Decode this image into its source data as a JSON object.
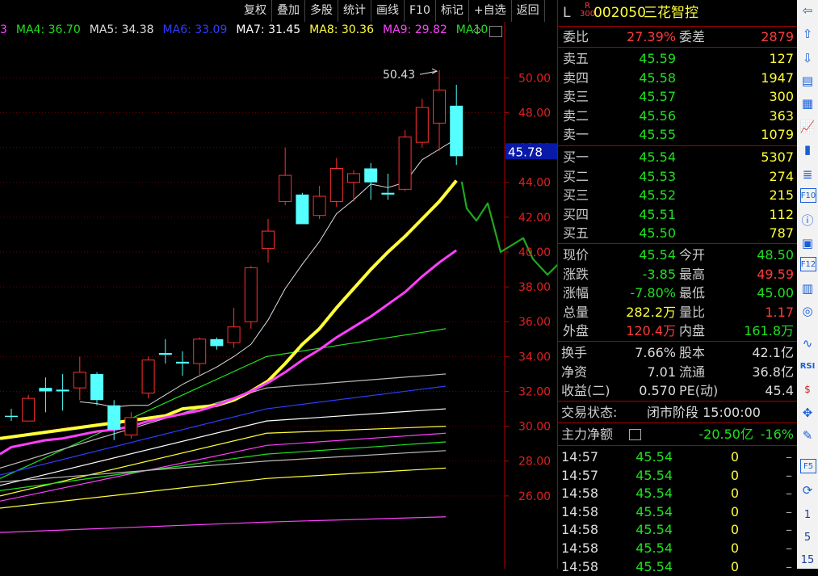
{
  "toolbar": {
    "buttons": [
      "复权",
      "叠加",
      "多股",
      "统计",
      "画线",
      "F10",
      "标记",
      "+自选",
      "返回"
    ]
  },
  "ma_bar": [
    {
      "label": "3",
      "color": "#ff40ff"
    },
    {
      "label": "MA4: 36.70",
      "color": "#21e021"
    },
    {
      "label": "MA5: 34.38",
      "color": "#dddddd"
    },
    {
      "label": "MA6: 33.09",
      "color": "#2f3cff"
    },
    {
      "label": "MA7: 31.45",
      "color": "#ffffff"
    },
    {
      "label": "MA8: 30.36",
      "color": "#ffff3a"
    },
    {
      "label": "MA9: 29.82",
      "color": "#ff40ff"
    },
    {
      "label": "MA10",
      "color": "#21e021"
    }
  ],
  "chart_data": {
    "type": "candlestick",
    "y_ticks": [
      "50.00",
      "48.00",
      "46.00",
      "44.00",
      "42.00",
      "40.00",
      "38.00",
      "36.00",
      "34.00",
      "32.00",
      "30.00",
      "28.00",
      "26.00"
    ],
    "ylim": [
      24.0,
      51.5
    ],
    "current_price_label": "45.78",
    "current_price": 45.78,
    "high_marker": "50.43",
    "high_marker_value": 50.43,
    "candles": [
      {
        "open": 30.6,
        "close": 30.6,
        "high": 31.0,
        "low": 30.3,
        "color": "cyan"
      },
      {
        "open": 30.3,
        "close": 31.6,
        "high": 31.8,
        "low": 30.3,
        "color": "red"
      },
      {
        "open": 32.0,
        "close": 32.2,
        "high": 32.8,
        "low": 30.8,
        "color": "cyan"
      },
      {
        "open": 32.1,
        "close": 32.0,
        "high": 33.0,
        "low": 30.9,
        "color": "cyan"
      },
      {
        "open": 32.2,
        "close": 33.1,
        "high": 34.0,
        "low": 31.5,
        "color": "red"
      },
      {
        "open": 33.0,
        "close": 31.5,
        "high": 33.1,
        "low": 31.2,
        "color": "cyan"
      },
      {
        "open": 31.2,
        "close": 29.8,
        "high": 31.5,
        "low": 29.2,
        "color": "cyan"
      },
      {
        "open": 29.5,
        "close": 30.5,
        "high": 30.8,
        "low": 29.3,
        "color": "red"
      },
      {
        "open": 31.9,
        "close": 33.8,
        "high": 34.0,
        "low": 31.6,
        "color": "red"
      },
      {
        "open": 34.1,
        "close": 34.2,
        "high": 35.0,
        "low": 33.6,
        "color": "cyan"
      },
      {
        "open": 33.6,
        "close": 33.7,
        "high": 34.3,
        "low": 32.9,
        "color": "cyan"
      },
      {
        "open": 33.6,
        "close": 35.0,
        "high": 35.1,
        "low": 32.9,
        "color": "red"
      },
      {
        "open": 35.0,
        "close": 34.6,
        "high": 35.1,
        "low": 34.4,
        "color": "cyan"
      },
      {
        "open": 34.8,
        "close": 35.7,
        "high": 36.8,
        "low": 34.5,
        "color": "red"
      },
      {
        "open": 36.0,
        "close": 39.1,
        "high": 39.2,
        "low": 35.6,
        "color": "red"
      },
      {
        "open": 40.2,
        "close": 41.2,
        "high": 41.9,
        "low": 39.4,
        "color": "red"
      },
      {
        "open": 42.9,
        "close": 44.4,
        "high": 46.0,
        "low": 42.7,
        "color": "red"
      },
      {
        "open": 43.3,
        "close": 41.6,
        "high": 43.4,
        "low": 41.6,
        "color": "cyan"
      },
      {
        "open": 42.1,
        "close": 43.2,
        "high": 43.8,
        "low": 41.9,
        "color": "red"
      },
      {
        "open": 42.9,
        "close": 44.8,
        "high": 45.4,
        "low": 42.6,
        "color": "red"
      },
      {
        "open": 44.0,
        "close": 44.5,
        "high": 44.7,
        "low": 42.9,
        "color": "red"
      },
      {
        "open": 44.8,
        "close": 44.0,
        "high": 45.1,
        "low": 43.0,
        "color": "cyan"
      },
      {
        "open": 43.3,
        "close": 43.4,
        "high": 44.5,
        "low": 43.0,
        "color": "cyan"
      },
      {
        "open": 43.6,
        "close": 46.6,
        "high": 47.0,
        "low": 43.5,
        "color": "red"
      },
      {
        "open": 46.3,
        "close": 48.3,
        "high": 48.8,
        "low": 46.0,
        "color": "red"
      },
      {
        "open": 47.4,
        "close": 49.3,
        "high": 50.43,
        "low": 45.8,
        "color": "red"
      },
      {
        "open": 48.4,
        "close": 45.5,
        "high": 49.6,
        "low": 45.0,
        "color": "cyan"
      }
    ],
    "ma_lines": [
      {
        "name": "MA5",
        "color": "#dddddd",
        "width": 1,
        "values": [
          null,
          null,
          null,
          null,
          31.4,
          31.3,
          31.1,
          31.2,
          31.2,
          31.8,
          32.4,
          32.9,
          33.4,
          34.0,
          34.7,
          36.1,
          37.9,
          39.3,
          40.6,
          42.2,
          43.0,
          43.9,
          43.7,
          44.0,
          45.3,
          45.9,
          46.5
        ]
      },
      {
        "name": "MA10",
        "color": "#ffff3a",
        "width": 4,
        "values": [
          null,
          null,
          null,
          null,
          null,
          null,
          null,
          null,
          null,
          30.6,
          31.0,
          31.1,
          31.2,
          31.5,
          32.0,
          32.6,
          33.6,
          34.7,
          35.6,
          36.8,
          37.9,
          39.0,
          40.0,
          40.9,
          41.9,
          42.9,
          44.1
        ]
      },
      {
        "name": "MA20",
        "color": "#ff40ff",
        "width": 3,
        "values": [
          28.8,
          29.0,
          29.2,
          29.3,
          29.5,
          29.7,
          29.8,
          30.0,
          30.3,
          30.5,
          30.7,
          30.9,
          31.2,
          31.6,
          32.0,
          32.5,
          33.1,
          33.8,
          34.4,
          35.1,
          35.7,
          36.3,
          37.0,
          37.7,
          38.6,
          39.4,
          40.1
        ]
      }
    ],
    "thin_lines": [
      {
        "color": "#21e021",
        "values": [
          27.0,
          34.0,
          35.6
        ]
      },
      {
        "color": "#bbbbbb",
        "values": [
          27.6,
          32.2,
          33.0
        ]
      },
      {
        "color": "#2f3cff",
        "values": [
          27.2,
          31.0,
          32.3
        ]
      },
      {
        "color": "#ffffff",
        "values": [
          26.6,
          30.3,
          31.0
        ]
      },
      {
        "color": "#ffff3a",
        "values": [
          26.0,
          29.6,
          30.0
        ]
      },
      {
        "color": "#ff40ff",
        "values": [
          25.7,
          28.9,
          29.6
        ]
      },
      {
        "color": "#21e021",
        "values": [
          26.3,
          28.4,
          29.1
        ]
      },
      {
        "color": "#bbbbbb",
        "values": [
          26.8,
          28.0,
          28.6
        ]
      },
      {
        "color": "#ffff3a",
        "values": [
          25.3,
          27.0,
          27.6
        ]
      },
      {
        "color": "#ff40ff",
        "values": [
          23.9,
          24.5,
          24.8
        ]
      }
    ],
    "annotation": {
      "color": "#1fa81f",
      "values": [
        44.0,
        42.5,
        41.8,
        42.8,
        40.0,
        40.8,
        39.6,
        38.7,
        39.7,
        38.4,
        37.1
      ]
    }
  },
  "panel": {
    "market_tag": "L",
    "r_tag": "R",
    "r_sub": "300",
    "code": "002050",
    "name": "三花智控",
    "weibi_label": "委比",
    "weibi_value": "27.39%",
    "weicha_label": "委差",
    "weicha_value": "2879",
    "asks": [
      {
        "label": "卖五",
        "price": "45.59",
        "vol": "127"
      },
      {
        "label": "卖四",
        "price": "45.58",
        "vol": "1947"
      },
      {
        "label": "卖三",
        "price": "45.57",
        "vol": "300"
      },
      {
        "label": "卖二",
        "price": "45.56",
        "vol": "363"
      },
      {
        "label": "卖一",
        "price": "45.55",
        "vol": "1079"
      }
    ],
    "bids": [
      {
        "label": "买一",
        "price": "45.54",
        "vol": "5307"
      },
      {
        "label": "买二",
        "price": "45.53",
        "vol": "274"
      },
      {
        "label": "买三",
        "price": "45.52",
        "vol": "215"
      },
      {
        "label": "买四",
        "price": "45.51",
        "vol": "112"
      },
      {
        "label": "买五",
        "price": "45.50",
        "vol": "787"
      }
    ],
    "stats": [
      {
        "l1": "现价",
        "v1": "45.54",
        "c1": "green",
        "l2": "今开",
        "v2": "48.50",
        "c2": "green"
      },
      {
        "l1": "涨跌",
        "v1": "-3.85",
        "c1": "green",
        "l2": "最高",
        "v2": "49.59",
        "c2": "red"
      },
      {
        "l1": "涨幅",
        "v1": "-7.80%",
        "c1": "green",
        "l2": "最低",
        "v2": "45.00",
        "c2": "green"
      },
      {
        "l1": "总量",
        "v1": "282.2万",
        "c1": "yellow",
        "l2": "量比",
        "v2": "1.17",
        "c2": "red"
      },
      {
        "l1": "外盘",
        "v1": "120.4万",
        "c1": "red",
        "l2": "内盘",
        "v2": "161.8万",
        "c2": "green"
      }
    ],
    "fund": [
      {
        "l1": "换手",
        "v1": "7.66%",
        "l2": "股本",
        "v2": "42.1亿"
      },
      {
        "l1": "净资",
        "v1": "7.01",
        "l2": "流通",
        "v2": "36.8亿"
      },
      {
        "l1": "收益(二)",
        "v1": "0.570",
        "l2": "PE(动)",
        "v2": "45.4"
      }
    ],
    "trade_status_label": "交易状态:",
    "trade_status_value": "闭市阶段 15:00:00",
    "main_flow_label": "主力净额",
    "main_flow_value": "-20.50亿",
    "main_flow_pct": "-16%",
    "ticks": [
      {
        "time": "14:57",
        "price": "45.54",
        "vol": "0",
        "flag": "–"
      },
      {
        "time": "14:57",
        "price": "45.54",
        "vol": "0",
        "flag": "–"
      },
      {
        "time": "14:58",
        "price": "45.54",
        "vol": "0",
        "flag": "–"
      },
      {
        "time": "14:58",
        "price": "45.54",
        "vol": "0",
        "flag": "–"
      },
      {
        "time": "14:58",
        "price": "45.54",
        "vol": "0",
        "flag": "–"
      },
      {
        "time": "14:58",
        "price": "45.54",
        "vol": "0",
        "flag": "–"
      },
      {
        "time": "14:58",
        "price": "45.54",
        "vol": "0",
        "flag": "–"
      }
    ]
  },
  "rail": {
    "icons": [
      "arrow-left-icon",
      "arrow-up-icon",
      "arrow-down-icon",
      "quote-icon",
      "table-icon",
      "line-chart-icon",
      "kline-icon",
      "news-icon",
      "f10-icon",
      "info-icon",
      "profile-icon",
      "f12-icon",
      "compare-icon",
      "circle-icon",
      "wave-icon",
      "rsi-icon",
      "money-icon",
      "move-icon",
      "pen-icon",
      "f5-icon",
      "refresh-icon",
      "period-1-icon",
      "period-5-icon",
      "period-15-icon"
    ],
    "labels": [
      "",
      "",
      "",
      "",
      "",
      "",
      "",
      "",
      "F10",
      "",
      "",
      "F12",
      "",
      "",
      "",
      "RSI",
      "$",
      "",
      "",
      "F5",
      "",
      "1",
      "5",
      "15"
    ]
  }
}
